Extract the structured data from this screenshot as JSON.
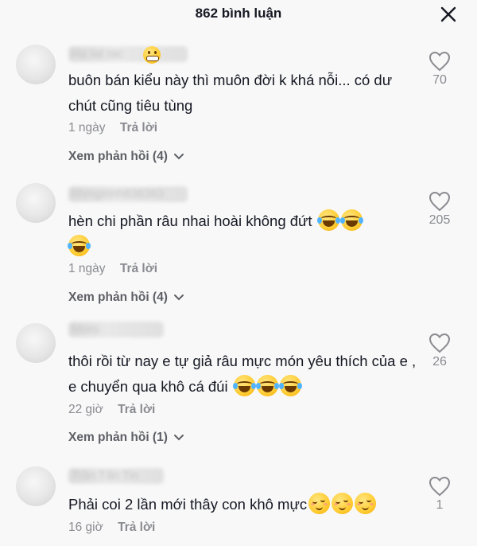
{
  "header": {
    "title": "862 bình luận"
  },
  "comments": [
    {
      "username": "Ha tat rac",
      "text": "buôn bán kiểu này thì muôn đời k khá nỗi... có dư chút cũng tiêu tùng",
      "time": "1 ngày",
      "reply_label": "Trả lời",
      "view_replies": "Xem phản hồi (4)",
      "likes": "70"
    },
    {
      "username": "hhmgirinh838363",
      "text": "hèn chi phần râu nhai hoài không đứt",
      "emojis": [
        "laugh",
        "laugh",
        "laugh"
      ],
      "time": "1 ngày",
      "reply_label": "Trả lời",
      "view_replies": "Xem phản hồi (4)",
      "likes": "205"
    },
    {
      "username": "Moro",
      "text": "thôi rồi từ nay e tự giả râu mực món yêu thích của e , e chuyển qua khô cá đúi",
      "emojis": [
        "laugh",
        "laugh",
        "laugh"
      ],
      "time": "22 giờ",
      "reply_label": "Trả lời",
      "view_replies": "Xem phản hồi (1)",
      "likes": "26"
    },
    {
      "username": "Trần Tấn Tin",
      "text": "Phải coi 2 lần mới thây con khô mực",
      "emojis": [
        "relief",
        "relief",
        "relief"
      ],
      "time": "16 giờ",
      "reply_label": "Trả lời",
      "likes": "1"
    }
  ],
  "icons": {
    "close": "close-icon",
    "like": "heart-outline-icon",
    "expand": "chevron-down-icon"
  }
}
